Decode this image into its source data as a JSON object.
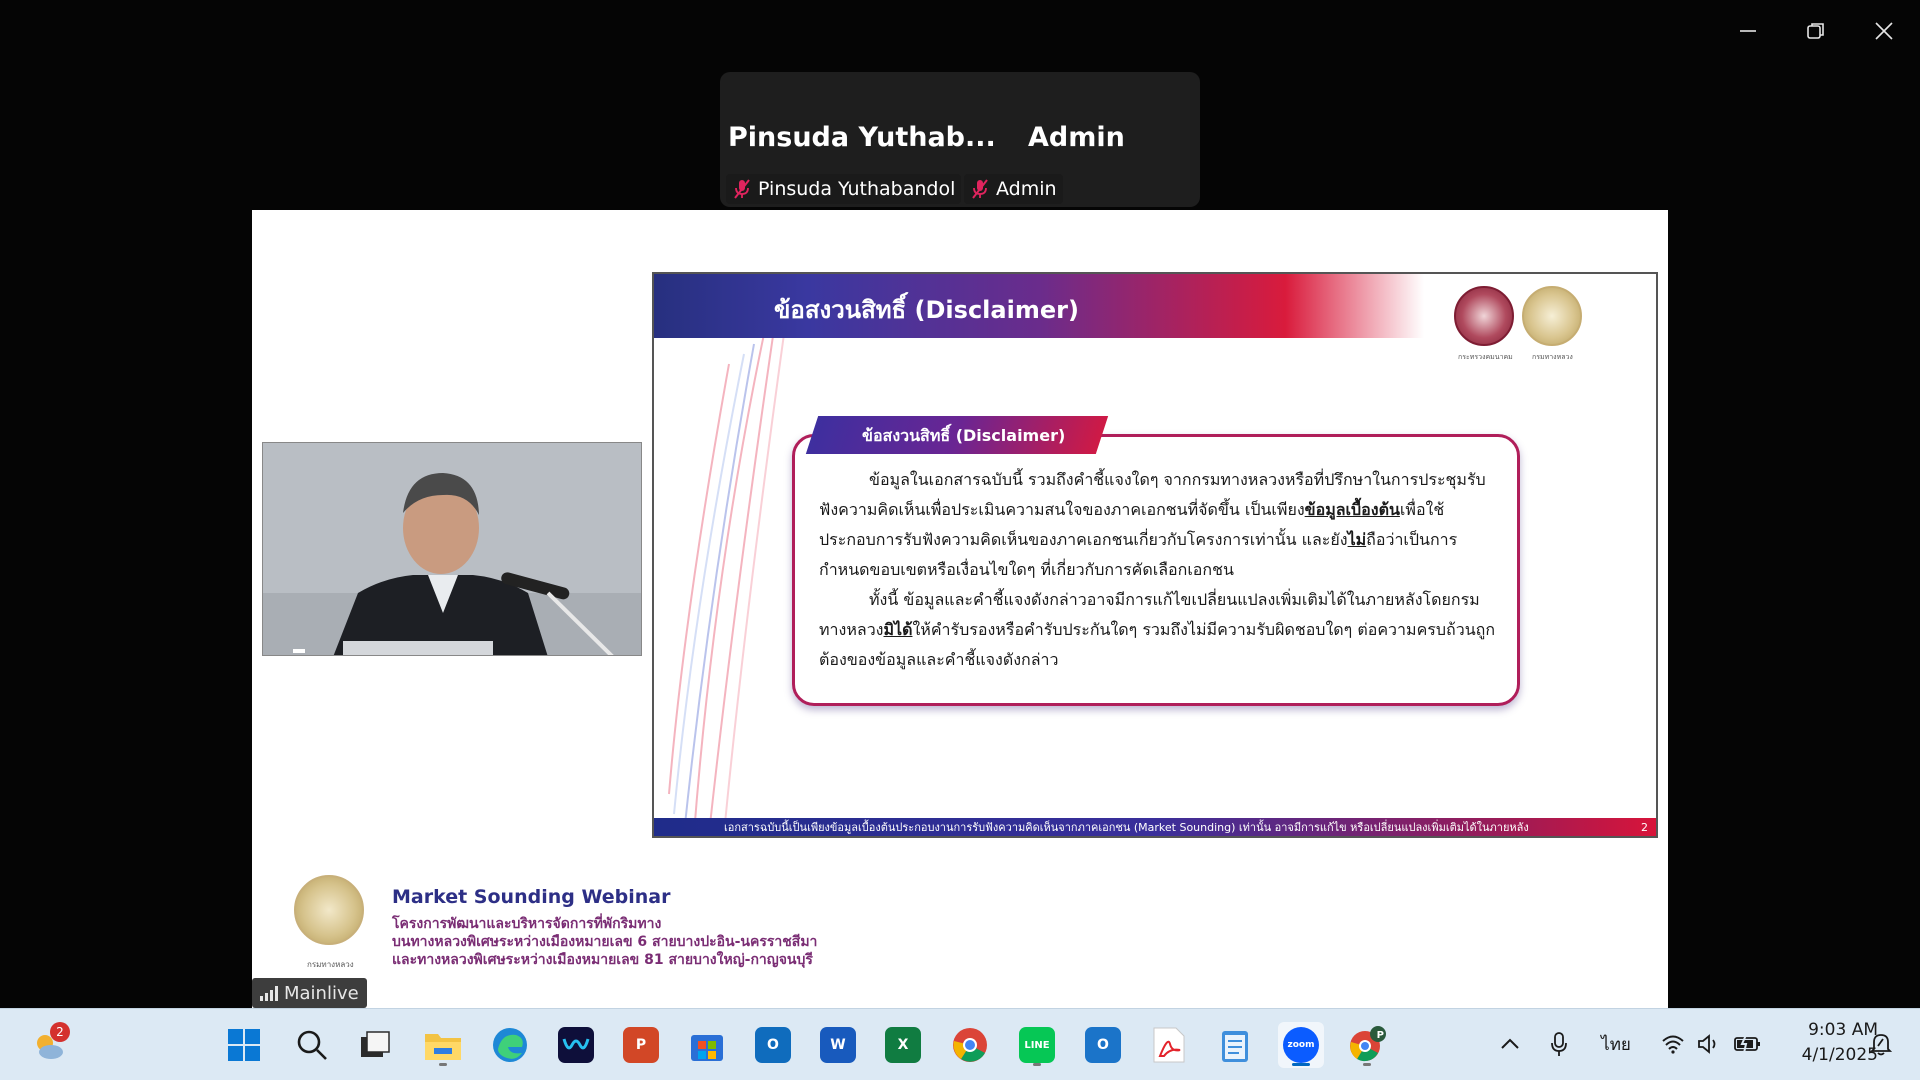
{
  "window": {
    "controls": [
      "minimize-icon",
      "restore-icon",
      "close-icon"
    ]
  },
  "participants": [
    {
      "display_name": "Pinsuda  Yuthab...",
      "tag_name": "Pinsuda Yuthabandol",
      "mic": "mic-muted-icon"
    },
    {
      "display_name": "Admin",
      "tag_name": "Admin",
      "mic": "mic-muted-icon"
    }
  ],
  "slide": {
    "title": "ข้อสงวนสิทธิ์ (Disclaimer)",
    "card_tab": "ข้อสงวนสิทธิ์ (Disclaimer)",
    "p1_a": "ข้อมูลในเอกสารฉบับนี้ รวมถึงคำชี้แจงใดๆ จากกรมทางหลวงหรือที่ปรึกษาในการประชุมรับฟังความคิดเห็นเพื่อประเมินความสนใจของภาคเอกชนที่จัดขึ้น เป็นเพียง",
    "p1_u1": "ข้อมูลเบื้องต้น",
    "p1_b": "เพื่อใช้ประกอบการรับฟังความคิดเห็นของภาคเอกชนเกี่ยวกับโครงการเท่านั้น และยัง",
    "p1_u2": "ไม่",
    "p1_c": "ถือว่าเป็นการกำหนดขอบเขตหรือเงื่อนไขใดๆ ที่เกี่ยวกับการคัดเลือกเอกชน",
    "p2_a": "ทั้งนี้ ข้อมูลและคำชี้แจงดังกล่าวอาจมีการแก้ไขเปลี่ยนแปลงเพิ่มเติมได้ในภายหลังโดยกรมทางหลวง",
    "p2_u": "มิได้",
    "p2_b": "ให้คำรับรองหรือคำรับประกันใดๆ รวมถึงไม่มีความรับผิดชอบใดๆ ต่อความครบถ้วนถูกต้องของข้อมูลและคำชี้แจงดังกล่าว",
    "footer": "เอกสารฉบับนี้เป็นเพียงข้อมูลเบื้องต้นประกอบงานการรับฟังความคิดเห็นจากภาคเอกชน (Market Sounding) เท่านั้น อาจมีการแก้ไข หรือเปลี่ยนแปลงเพิ่มเติมได้ในภายหลัง",
    "page_number": "2",
    "seal1_caption": "กระทรวงคมนาคม",
    "seal2_caption": "กรมทางหลวง"
  },
  "lower": {
    "logo_caption": "กรมทางหลวง",
    "webinar_title": "Market Sounding Webinar",
    "line1": "โครงการพัฒนาและบริหารจัดการที่พักริมทาง",
    "line2": "บนทางหลวงพิเศษระหว่างเมืองหมายเลข 6 สายบางปะอิน-นครราชสีมา",
    "line3": "และทางหลวงพิเศษระหว่างเมืองหมายเลข 81 สายบางใหญ่-กาญจนบุรี"
  },
  "mainlive": {
    "label": "Mainlive"
  },
  "taskbar": {
    "weather_badge": "2",
    "apps": [
      {
        "name": "start-button",
        "label": ""
      },
      {
        "name": "search-icon",
        "label": ""
      },
      {
        "name": "task-view-icon",
        "label": ""
      },
      {
        "name": "file-explorer-icon",
        "label": ""
      },
      {
        "name": "edge-icon",
        "label": ""
      },
      {
        "name": "webex-icon",
        "label": ""
      },
      {
        "name": "powerpoint-icon",
        "label": "P"
      },
      {
        "name": "microsoft-store-icon",
        "label": ""
      },
      {
        "name": "outlook-icon",
        "label": "O"
      },
      {
        "name": "word-icon",
        "label": "W"
      },
      {
        "name": "excel-icon",
        "label": "X"
      },
      {
        "name": "chrome-icon",
        "label": ""
      },
      {
        "name": "line-icon",
        "label": "LINE"
      },
      {
        "name": "outlook-new-icon",
        "label": "O"
      },
      {
        "name": "acrobat-icon",
        "label": ""
      },
      {
        "name": "notepad-icon",
        "label": ""
      },
      {
        "name": "zoom-icon",
        "label": "zoom"
      },
      {
        "name": "chrome-profile-icon",
        "label": "P"
      }
    ],
    "language": "ไทย",
    "time": "9:03 AM",
    "date": "4/1/2025"
  }
}
